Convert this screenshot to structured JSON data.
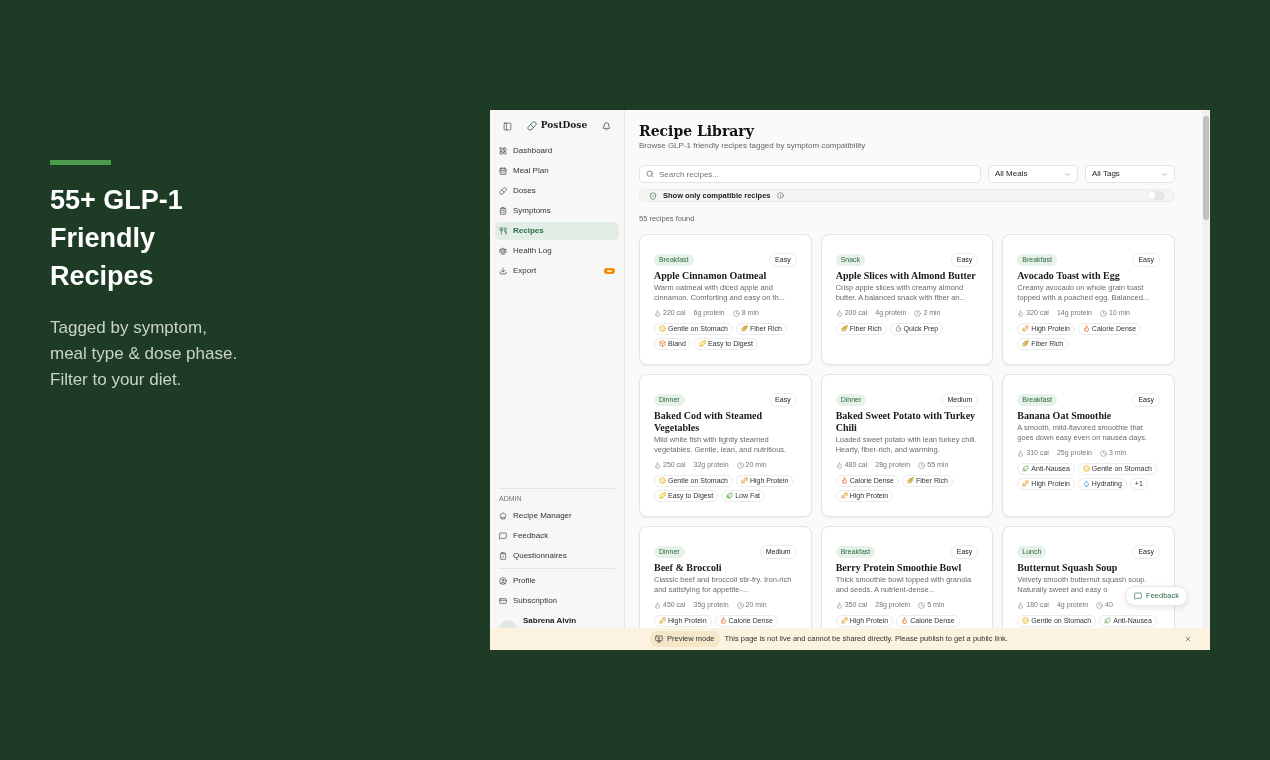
{
  "promo": {
    "title_lines": [
      "55+ GLP-1",
      "Friendly",
      "Recipes"
    ],
    "body_lines": [
      "Tagged by symptom,",
      "meal type & dose phase.",
      "Filter to your diet."
    ]
  },
  "sidebar": {
    "brand": "PostDose",
    "items": [
      {
        "label": "Dashboard",
        "selected": false
      },
      {
        "label": "Meal Plan",
        "selected": false
      },
      {
        "label": "Doses",
        "selected": false
      },
      {
        "label": "Symptoms",
        "selected": false
      },
      {
        "label": "Recipes",
        "selected": true
      },
      {
        "label": "Health Log",
        "selected": false
      },
      {
        "label": "Export",
        "selected": false,
        "badge": true
      }
    ],
    "admin_heading": "ADMIN",
    "admin_items": [
      {
        "label": "Recipe Manager"
      },
      {
        "label": "Feedback"
      },
      {
        "label": "Questionnaires"
      }
    ],
    "account_items": [
      {
        "label": "Profile"
      },
      {
        "label": "Subscription"
      }
    ],
    "user_name": "Sabrena Alvin"
  },
  "main": {
    "title": "Recipe Library",
    "subtitle": "Browse GLP-1 friendly recipes tagged by symptom compatibility",
    "search": {
      "placeholder": "Search recipes..."
    },
    "filters": [
      "All Meals",
      "All Tags"
    ],
    "compatible_toggle": {
      "label": "Show only compatible recipes",
      "on": false
    },
    "count": "55 recipes found",
    "cards": [
      {
        "category": "Breakfast",
        "difficulty": "Easy",
        "title": "Apple Cinnamon Oatmeal",
        "desc": "Warm oatmeal with diced apple and cinnamon. Comforting and easy on th...",
        "cal": "220 cal",
        "protein": "6g protein",
        "time": "8 min",
        "tags": [
          {
            "kind": "stomach",
            "label": "Gentle on Stomach"
          },
          {
            "kind": "fiber",
            "label": "Fiber Rich"
          },
          {
            "kind": "bland",
            "label": "Bland"
          },
          {
            "kind": "digest",
            "label": "Easy to Digest"
          }
        ]
      },
      {
        "category": "Snack",
        "difficulty": "Easy",
        "title": "Apple Slices with Almond Butter",
        "desc": "Crisp apple slices with creamy almond butter. A balanced snack with fiber an...",
        "cal": "200 cal",
        "protein": "4g protein",
        "time": "2 min",
        "tags": [
          {
            "kind": "fiber",
            "label": "Fiber Rich"
          },
          {
            "kind": "quick",
            "label": "Quick Prep"
          }
        ]
      },
      {
        "category": "Breakfast",
        "difficulty": "Easy",
        "title": "Avocado Toast with Egg",
        "desc": "Creamy avocado on whole grain toast topped with a poached egg. Balanced...",
        "cal": "320 cal",
        "protein": "14g protein",
        "time": "10 min",
        "tags": [
          {
            "kind": "protein",
            "label": "High Protein"
          },
          {
            "kind": "calorie",
            "label": "Calorie Dense"
          },
          {
            "kind": "fiber",
            "label": "Fiber Rich"
          }
        ]
      },
      {
        "category": "Dinner",
        "difficulty": "Easy",
        "title": "Baked Cod with Steamed Vegetables",
        "desc": "Mild white fish with lightly steamed vegetables. Gentle, lean, and nutritious.",
        "cal": "250 cal",
        "protein": "32g protein",
        "time": "20 min",
        "tags": [
          {
            "kind": "stomach",
            "label": "Gentle on Stomach"
          },
          {
            "kind": "protein",
            "label": "High Protein"
          },
          {
            "kind": "digest",
            "label": "Easy to Digest"
          },
          {
            "kind": "lowfat",
            "label": "Low Fat"
          }
        ]
      },
      {
        "category": "Dinner",
        "difficulty": "Medium",
        "title": "Baked Sweet Potato with Turkey Chili",
        "desc": "Loaded sweet potato with lean turkey chili. Hearty, fiber-rich, and warming.",
        "cal": "480 cal",
        "protein": "28g protein",
        "time": "55 min",
        "tags": [
          {
            "kind": "calorie",
            "label": "Calorie Dense"
          },
          {
            "kind": "fiber",
            "label": "Fiber Rich"
          },
          {
            "kind": "protein",
            "label": "High Protein"
          }
        ]
      },
      {
        "category": "Breakfast",
        "difficulty": "Easy",
        "title": "Banana Oat Smoothie",
        "desc": "A smooth, mild-flavored smoothie that goes down easy even on nausea days.",
        "cal": "310 cal",
        "protein": "25g protein",
        "time": "3 min",
        "tags": [
          {
            "kind": "nausea",
            "label": "Anti-Nausea"
          },
          {
            "kind": "stomach",
            "label": "Gentle on Stomach"
          },
          {
            "kind": "protein",
            "label": "High Protein"
          },
          {
            "kind": "hydrating",
            "label": "Hydrating"
          },
          {
            "kind": "more",
            "label": "+1"
          }
        ]
      },
      {
        "category": "Dinner",
        "difficulty": "Medium",
        "title": "Beef & Broccoli",
        "desc": "Classic beef and broccoli stir-fry. Iron-rich and satisfying for appetite-...",
        "cal": "450 cal",
        "protein": "35g protein",
        "time": "20 min",
        "tags": [
          {
            "kind": "protein",
            "label": "High Protein"
          },
          {
            "kind": "calorie",
            "label": "Calorie Dense"
          }
        ]
      },
      {
        "category": "Breakfast",
        "difficulty": "Easy",
        "title": "Berry Protein Smoothie Bowl",
        "desc": "Thick smoothie bowl topped with granola and seeds. A nutrient-dense...",
        "cal": "350 cal",
        "protein": "28g protein",
        "time": "5 min",
        "tags": [
          {
            "kind": "protein",
            "label": "High Protein"
          },
          {
            "kind": "calorie",
            "label": "Calorie Dense"
          }
        ]
      },
      {
        "category": "Lunch",
        "difficulty": "Easy",
        "title": "Butternut Squash Soup",
        "desc": "Velvety smooth butternut squash soup. Naturally sweet and easy o",
        "cal": "180 cal",
        "protein": "4g protein",
        "time": "40",
        "tags": [
          {
            "kind": "stomach",
            "label": "Gentle on Stomach"
          },
          {
            "kind": "nausea",
            "label": "Anti-Nausea"
          }
        ]
      }
    ],
    "feedback_button": "Feedback"
  },
  "preview_banner": {
    "badge": "Preview mode",
    "message": "This page is not live and cannot be shared directly. Please publish to get a public link."
  }
}
